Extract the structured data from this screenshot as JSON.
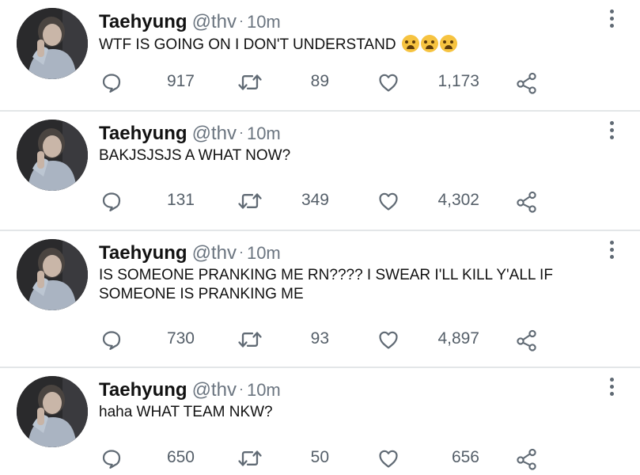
{
  "accent": "#6b7580",
  "icons": {
    "reply": "reply-icon",
    "retweet": "retweet-icon",
    "like": "heart-icon",
    "share": "share-icon",
    "more": "more-vertical-icon",
    "emoji": "loudly-crying-face-emoji"
  },
  "tweets": [
    {
      "name": "Taehyung",
      "handle": "@thv",
      "separator": "·",
      "time": "10m",
      "text": "WTF IS GOING ON I DON'T UNDERSTAND",
      "emoji_count": 3,
      "replies": "917",
      "retweets": "89",
      "likes": "1,173"
    },
    {
      "name": "Taehyung",
      "handle": "@thv",
      "separator": "·",
      "time": "10m",
      "text": "BAKJSJSJS A WHAT NOW?",
      "replies": "131",
      "retweets": "349",
      "likes": "4,302"
    },
    {
      "name": "Taehyung",
      "handle": "@thv",
      "separator": "·",
      "time": "10m",
      "text": "IS SOMEONE PRANKING ME RN???? I SWEAR I'LL KILL Y'ALL IF SOMEONE IS PRANKING ME",
      "replies": "730",
      "retweets": "93",
      "likes": "4,897"
    },
    {
      "name": "Taehyung",
      "handle": "@thv",
      "separator": "·",
      "time": "10m",
      "text": "haha WHAT TEAM NKW?",
      "replies": "650",
      "retweets": "50",
      "likes": "656"
    }
  ]
}
